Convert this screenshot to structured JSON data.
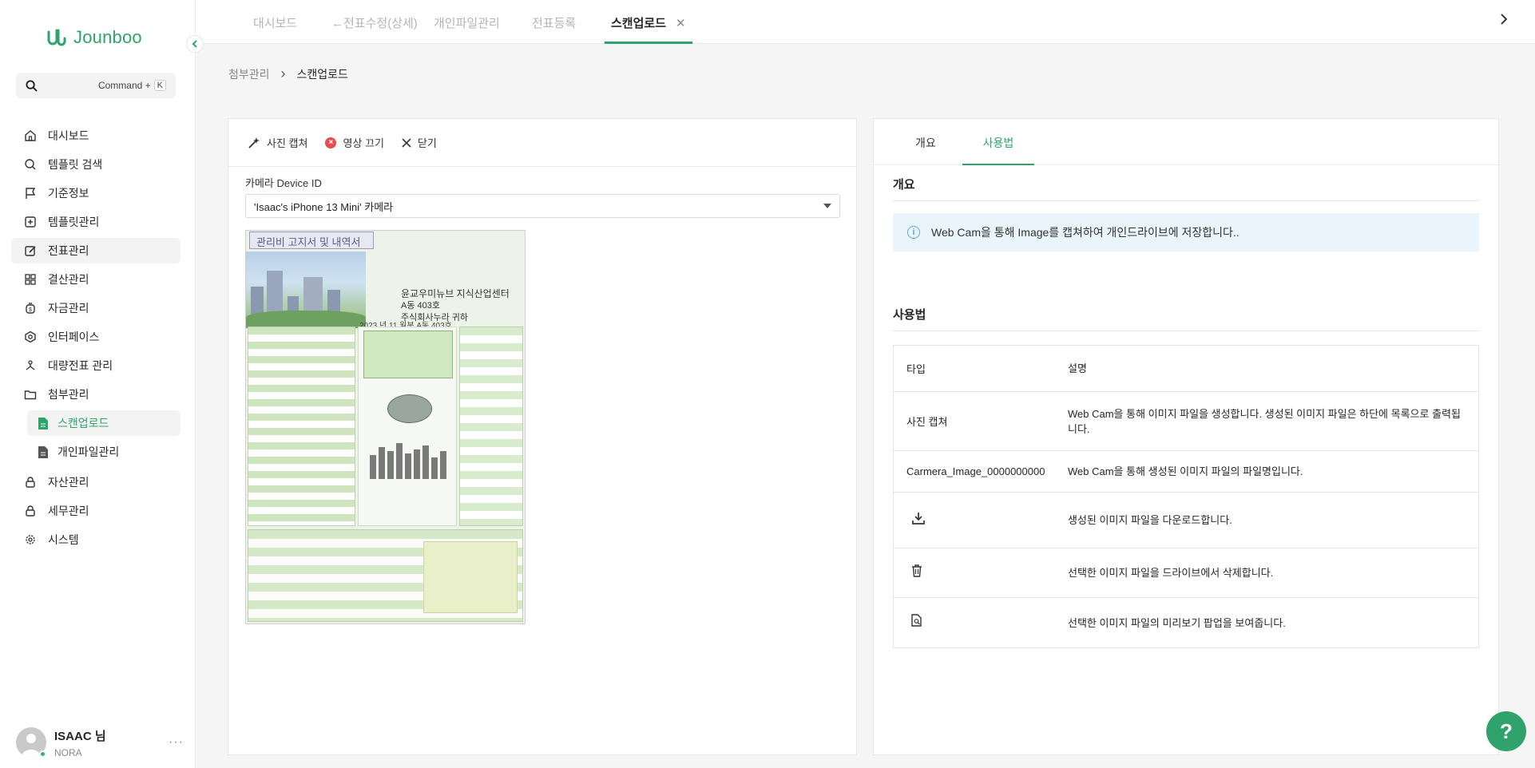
{
  "brand": {
    "name": "Jounboo",
    "color": "#2fa36b"
  },
  "search": {
    "shortcut": "Command +",
    "key": "K"
  },
  "sidebar": {
    "items": [
      {
        "label": "대시보드",
        "icon": "home-icon"
      },
      {
        "label": "템플릿 검색",
        "icon": "search-icon"
      },
      {
        "label": "기준정보",
        "icon": "flag-icon"
      },
      {
        "label": "템플릿관리",
        "icon": "template-icon"
      },
      {
        "label": "전표관리",
        "icon": "edit-icon"
      },
      {
        "label": "결산관리",
        "icon": "grid-icon"
      },
      {
        "label": "자금관리",
        "icon": "money-icon"
      },
      {
        "label": "인터페이스",
        "icon": "interface-icon"
      },
      {
        "label": "대량전표 관리",
        "icon": "bulk-icon"
      },
      {
        "label": "첨부관리",
        "icon": "folder-icon"
      },
      {
        "label": "스캔업로드",
        "icon": "file-icon"
      },
      {
        "label": "개인파일관리",
        "icon": "file-icon"
      },
      {
        "label": "자산관리",
        "icon": "lock-icon"
      },
      {
        "label": "세무관리",
        "icon": "lock-icon"
      },
      {
        "label": "시스템",
        "icon": "gear-icon"
      }
    ]
  },
  "user": {
    "name": "ISAAC 님",
    "org": "NORA",
    "more": "···"
  },
  "topTabs": [
    {
      "label": "대시보드"
    },
    {
      "label": "전표수정(상세)"
    },
    {
      "label": "개인파일관리"
    },
    {
      "label": "전표등록"
    },
    {
      "label": "스캔업로드"
    }
  ],
  "topTabClose": "✕",
  "breadcrumb": {
    "parent": "첨부관리",
    "sep": "›",
    "current": "스캔업로드"
  },
  "toolbar": {
    "capture": "사진 캡쳐",
    "stop": "영상 끄기",
    "close": "닫기"
  },
  "camera": {
    "label": "카메라 Device ID",
    "value": "'Isaac's iPhone 13 Mini' 카메라"
  },
  "scan": {
    "title": "관리비 고지서 및 내역서",
    "addressLine1": "윤교우미뉴브 지식산업센터",
    "addressLine2": "A동 403호",
    "addressLine3": "주식회사누라 귀하",
    "period": "2023 년 11 월분 A동 403호"
  },
  "rightTabs": {
    "overview": "개요",
    "usage": "사용법"
  },
  "overview": {
    "title": "개요",
    "info": "Web Cam을 통해 Image를 캡쳐하여 개인드라이브에 저장합니다.."
  },
  "usage": {
    "title": "사용법",
    "headers": {
      "type": "타입",
      "desc": "설명"
    },
    "rows": [
      {
        "type": "사진 캡쳐",
        "desc": "Web Cam을 통해 이미지 파일을 생성합니다. 생성된 이미지 파일은 하단에 목록으로 출력됩니다."
      },
      {
        "type": "Carmera_Image_0000000000",
        "desc": "Web Cam을 통해 생성된 이미지 파일의 파일명입니다."
      },
      {
        "type": "",
        "icon": "download-icon",
        "desc": "생성된 이미지 파일을 다운로드합니다."
      },
      {
        "type": "",
        "icon": "trash-icon",
        "desc": "선택한 이미지 파일을 드라이브에서 삭제합니다."
      },
      {
        "type": "",
        "icon": "preview-icon",
        "desc": "선택한 이미지 파일의 미리보기 팝업을 보여줍니다."
      }
    ]
  },
  "help": "?"
}
